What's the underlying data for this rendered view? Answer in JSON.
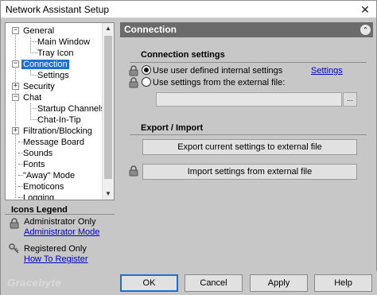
{
  "window": {
    "title": "Network Assistant Setup",
    "close_glyph": "✕"
  },
  "tree": {
    "items": [
      {
        "label": "General",
        "level": 0,
        "expander": "−"
      },
      {
        "label": "Main Window",
        "level": 1
      },
      {
        "label": "Tray Icon",
        "level": 1
      },
      {
        "label": "Connection",
        "level": 0,
        "expander": "−",
        "selected": true
      },
      {
        "label": "Settings",
        "level": 1
      },
      {
        "label": "Security",
        "level": 0,
        "expander": "+"
      },
      {
        "label": "Chat",
        "level": 0,
        "expander": "−"
      },
      {
        "label": "Startup Channels",
        "level": 1
      },
      {
        "label": "Chat-In-Tip",
        "level": 1
      },
      {
        "label": "Filtration/Blocking",
        "level": 0,
        "expander": "+"
      },
      {
        "label": "Message Board",
        "level": 0
      },
      {
        "label": "Sounds",
        "level": 0
      },
      {
        "label": "Fonts",
        "level": 0
      },
      {
        "label": "\"Away\" Mode",
        "level": 0
      },
      {
        "label": "Emoticons",
        "level": 0
      },
      {
        "label": "Logging",
        "level": 0
      }
    ],
    "scroll_up_glyph": "▲",
    "scroll_down_glyph": "▼"
  },
  "legend": {
    "title": "Icons Legend",
    "admin_label": "Administrator Only",
    "admin_link": "Administrator Mode",
    "registered_label": "Registered Only",
    "registered_link": "How To Register"
  },
  "panel": {
    "header": "Connection",
    "collapse_glyph": "⌃",
    "connection_settings": {
      "title": "Connection settings",
      "option_internal": "Use user defined internal settings",
      "option_external": "Use settings from the external file:",
      "settings_link": "Settings",
      "external_file_value": "",
      "browse_label": "..."
    },
    "export_import": {
      "title": "Export / Import",
      "export_button": "Export current settings to external file",
      "import_button": "Import settings from external file"
    }
  },
  "buttons": {
    "ok": "OK",
    "cancel": "Cancel",
    "apply": "Apply",
    "help": "Help"
  },
  "watermark": "Gracebyte",
  "colors": {
    "selection": "#1f6fd1",
    "header_bg": "#6b6b6b",
    "window_bg": "#c7c7c7",
    "link": "#0000cc"
  }
}
